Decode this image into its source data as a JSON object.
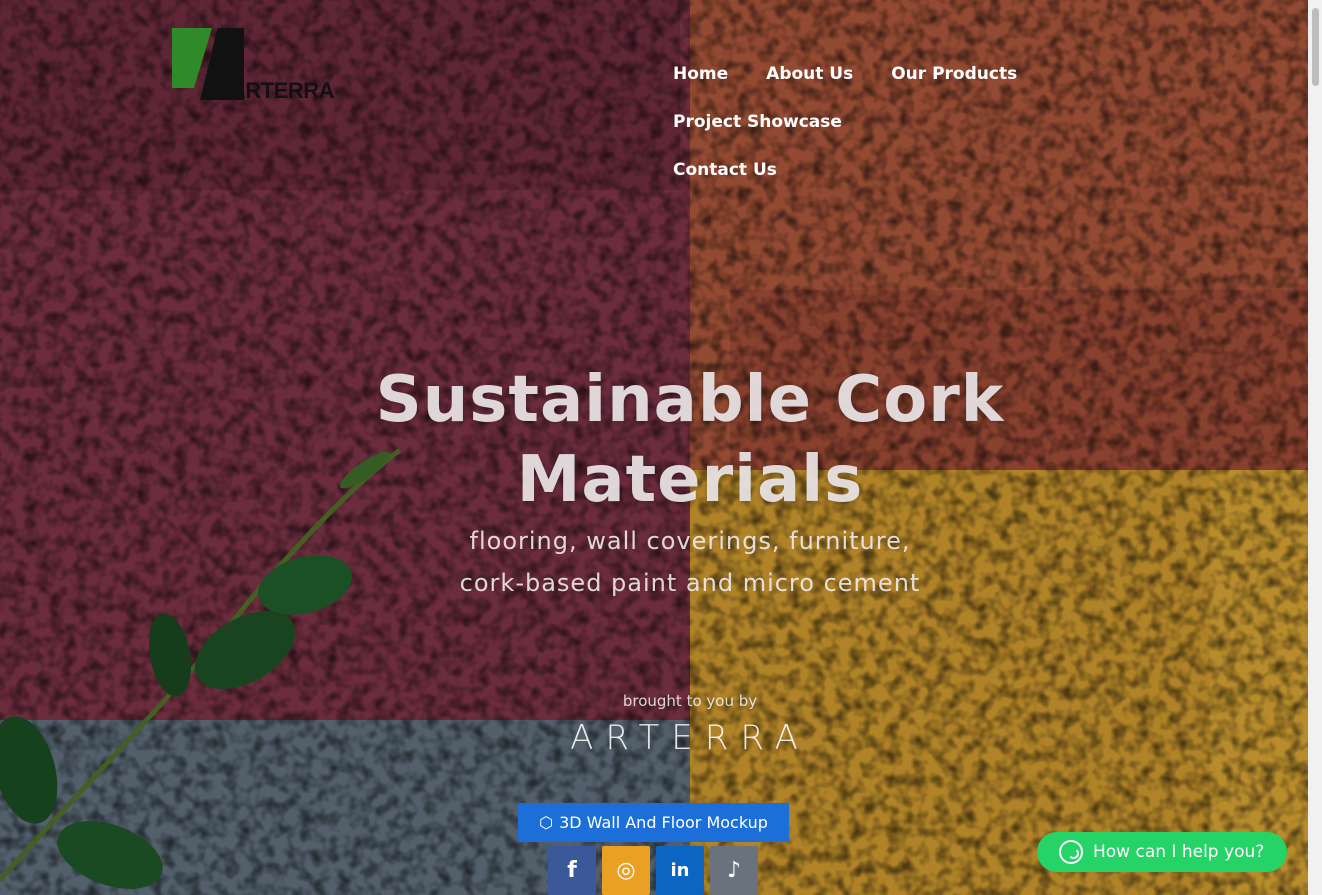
{
  "logo": {
    "text": "ARTERRA"
  },
  "nav": {
    "items": [
      "Home",
      "About Us",
      "Our Products",
      "Project Showcase",
      "Contact Us"
    ]
  },
  "hero": {
    "headline": "Sustainable Cork Materials",
    "subline_1": "flooring, wall coverings, furniture,",
    "subline_2": "cork-based paint and micro cement",
    "brought_by": "brought to you by",
    "brand": "ARTERRA",
    "mockup_button": "3D Wall And Floor Mockup"
  },
  "socials": [
    {
      "name": "facebook-icon",
      "glyph": "f",
      "color": "#3b5998"
    },
    {
      "name": "instagram-icon",
      "glyph": "◎",
      "color": "#e9a023"
    },
    {
      "name": "linkedin-icon",
      "glyph": "in",
      "color": "#0a66c2"
    },
    {
      "name": "tiktok-icon",
      "glyph": "♪",
      "color": "#69727d"
    }
  ],
  "whatsapp": {
    "label": "How can I help you?",
    "color": "#25d366"
  },
  "colors": {
    "button_blue": "#1c6fd9"
  }
}
